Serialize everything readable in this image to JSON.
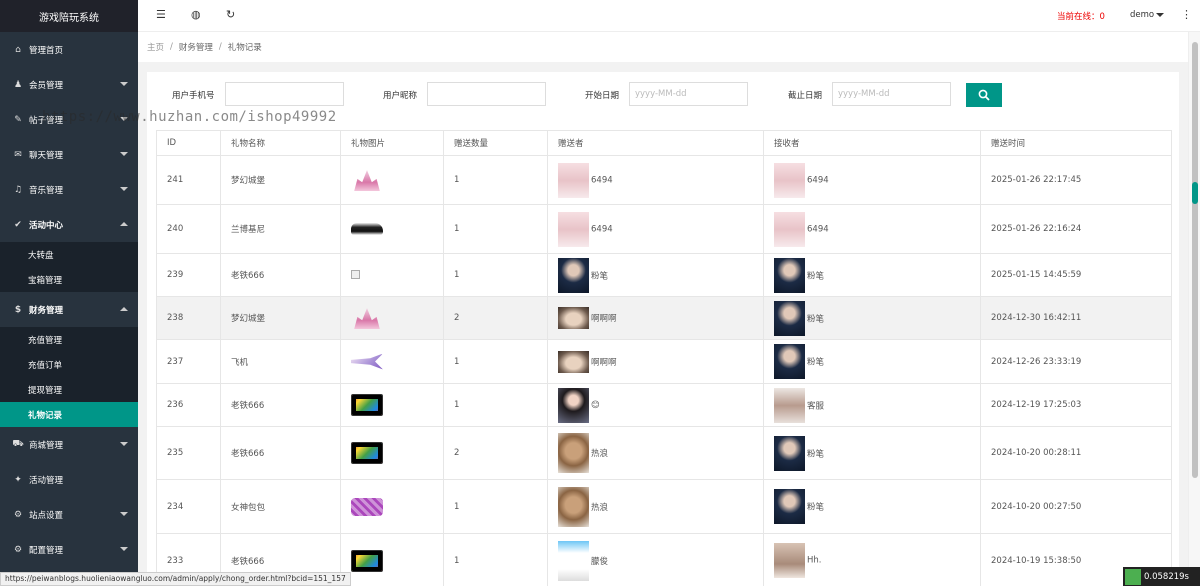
{
  "app_title": "游戏陪玩系统",
  "sidebar": {
    "items": [
      {
        "label": "管理首页",
        "icon": "home-icon",
        "glyph": "⌂",
        "caret": ""
      },
      {
        "label": "会员管理",
        "icon": "user-icon",
        "glyph": "♟",
        "caret": "down"
      },
      {
        "label": "帖子管理",
        "icon": "post-icon",
        "glyph": "✎",
        "caret": "down"
      },
      {
        "label": "聊天管理",
        "icon": "chat-icon",
        "glyph": "✉",
        "caret": "down"
      },
      {
        "label": "音乐管理",
        "icon": "music-icon",
        "glyph": "♫",
        "caret": "down"
      },
      {
        "label": "活动中心",
        "icon": "activity-icon",
        "glyph": "✔",
        "caret": "up",
        "bold": true
      },
      {
        "label": "财务管理",
        "icon": "finance-icon",
        "glyph": "$",
        "caret": "up",
        "bold": true
      },
      {
        "label": "商城管理",
        "icon": "cart-icon",
        "glyph": "⛟",
        "caret": "down"
      },
      {
        "label": "活动管理",
        "icon": "event-icon",
        "glyph": "✦",
        "caret": ""
      },
      {
        "label": "站点设置",
        "icon": "settings-icon",
        "glyph": "⚙",
        "caret": "down"
      },
      {
        "label": "配置管理",
        "icon": "config-icon",
        "glyph": "⚙",
        "caret": "down"
      }
    ],
    "activity_sub": [
      "大转盘",
      "宝箱管理"
    ],
    "finance_sub": [
      "充值管理",
      "充值订单",
      "提现管理",
      "礼物记录"
    ]
  },
  "topbar": {
    "online_label": "当前在线：0",
    "user": "demo"
  },
  "breadcrumb": {
    "home": "主页",
    "section": "财务管理",
    "page": "礼物记录"
  },
  "filters": {
    "phone_label": "用户手机号",
    "nick_label": "用户昵称",
    "start_label": "开始日期",
    "end_label": "截止日期",
    "date_placeholder": "yyyy-MM-dd"
  },
  "table": {
    "headers": [
      "ID",
      "礼物名称",
      "礼物图片",
      "赠送数量",
      "赠送者",
      "接收者",
      "赠送时间"
    ],
    "rows": [
      {
        "id": "241",
        "name": "梦幻城堡",
        "img": "castle",
        "count": "1",
        "sender": "6494",
        "sender_av": "girl",
        "receiver": "6494",
        "receiver_av": "girl",
        "time": "2025-01-26 22:17:45"
      },
      {
        "id": "240",
        "name": "兰博基尼",
        "img": "car",
        "count": "1",
        "sender": "6494",
        "sender_av": "girl",
        "receiver": "6494",
        "receiver_av": "girl",
        "time": "2025-01-26 22:16:24"
      },
      {
        "id": "239",
        "name": "老铁666",
        "img": "broken",
        "count": "1",
        "sender": "粉笔",
        "sender_av": "boy",
        "receiver": "粉笔",
        "receiver_av": "boy",
        "time": "2025-01-15 14:45:59"
      },
      {
        "id": "238",
        "name": "梦幻城堡",
        "img": "castle",
        "count": "2",
        "sender": "啊啊啊",
        "sender_av": "cat",
        "receiver": "粉笔",
        "receiver_av": "boy",
        "time": "2024-12-30 16:42:11"
      },
      {
        "id": "237",
        "name": "飞机",
        "img": "plane",
        "count": "1",
        "sender": "啊啊啊",
        "sender_av": "cat",
        "receiver": "粉笔",
        "receiver_av": "boy",
        "time": "2024-12-26 23:33:19"
      },
      {
        "id": "236",
        "name": "老铁666",
        "img": "six",
        "count": "1",
        "sender": "😊",
        "sender_av": "woman",
        "receiver": "客服",
        "receiver_av": "woman2",
        "time": "2024-12-19 17:25:03"
      },
      {
        "id": "235",
        "name": "老铁666",
        "img": "six",
        "count": "2",
        "sender": "热浪",
        "sender_av": "bear",
        "receiver": "粉笔",
        "receiver_av": "boy",
        "time": "2024-10-20 00:28:11"
      },
      {
        "id": "234",
        "name": "女神包包",
        "img": "bag",
        "count": "1",
        "sender": "热浪",
        "sender_av": "bear",
        "receiver": "粉笔",
        "receiver_av": "boy",
        "time": "2024-10-20 00:27:50"
      },
      {
        "id": "233",
        "name": "老铁666",
        "img": "six",
        "count": "1",
        "sender": "朦俊",
        "sender_av": "screen",
        "receiver": "Hh.",
        "receiver_av": "woman3",
        "time": "2024-10-19 15:38:50"
      }
    ]
  },
  "status_url": "https://peiwanblogs.huolieniaowangluo.com/admin/apply/chong_order.html?bcid=151_157",
  "timer": "0.058219s",
  "watermark": "https://www.huzhan.com/ishop49992",
  "colors": {
    "accent": "#009688",
    "sidebar": "#28333e",
    "online": "#ee0000"
  }
}
